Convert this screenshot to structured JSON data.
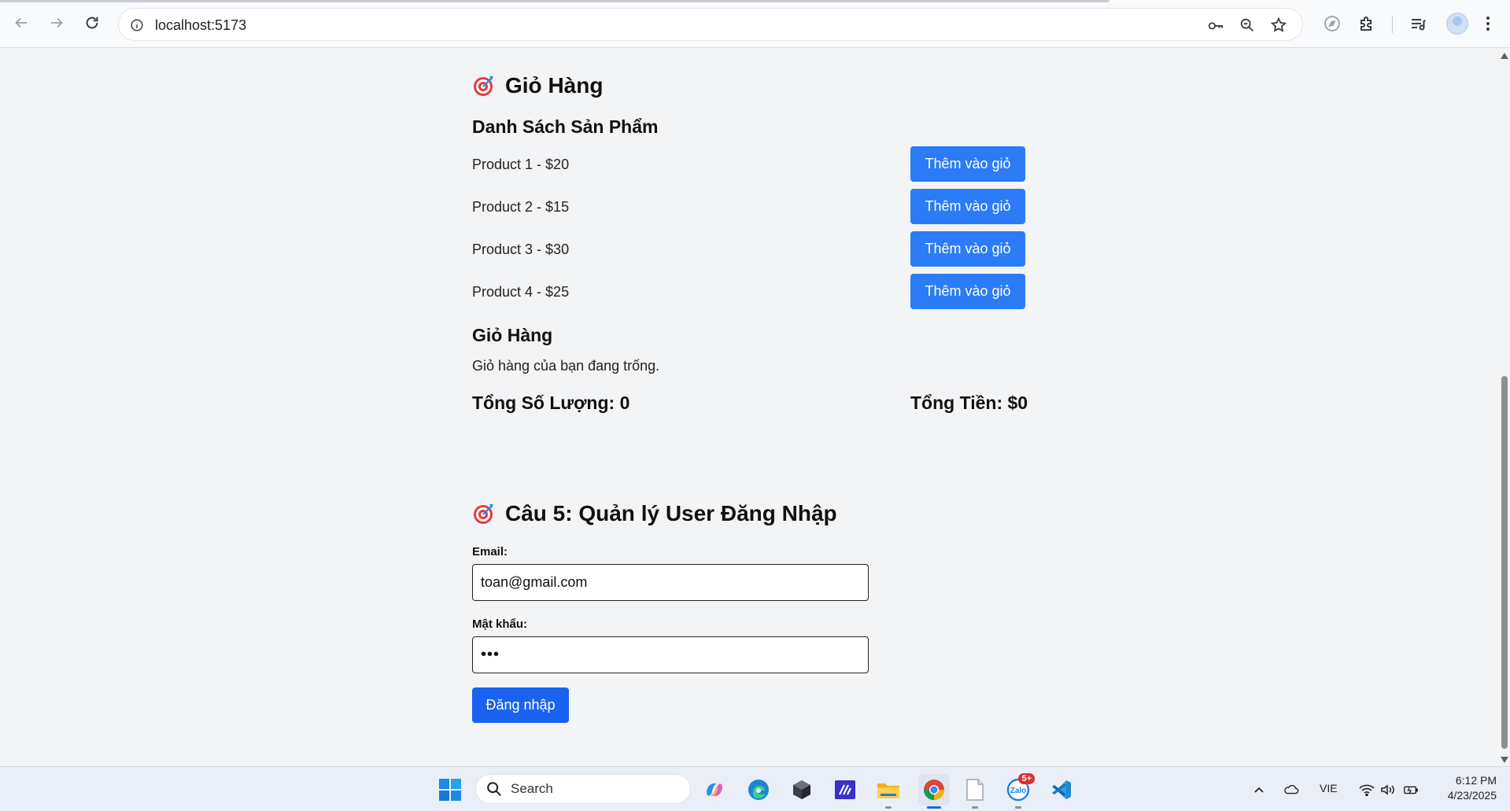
{
  "browser": {
    "url": "localhost:5173",
    "icons": [
      "back-icon",
      "forward-icon",
      "reload-icon",
      "site-info-icon",
      "password-key-icon",
      "zoom-icon",
      "bookmark-star-icon",
      "compass-icon",
      "extensions-icon",
      "media-control-icon",
      "profile-avatar",
      "more-menu-icon"
    ]
  },
  "cart_section": {
    "title": "Giỏ Hàng",
    "product_list_heading": "Danh Sách Sản Phẩm",
    "products": [
      {
        "label": "Product 1 - $20",
        "button": "Thêm vào giỏ"
      },
      {
        "label": "Product 2 - $15",
        "button": "Thêm vào giỏ"
      },
      {
        "label": "Product 3 - $30",
        "button": "Thêm vào giỏ"
      },
      {
        "label": "Product 4 - $25",
        "button": "Thêm vào giỏ"
      }
    ],
    "cart_heading": "Giỏ Hàng",
    "empty_message": "Giỏ hàng của bạn đang trống.",
    "total_quantity": "Tổng Số Lượng: 0",
    "total_price": "Tổng Tiền: $0"
  },
  "login_section": {
    "title": "Câu 5: Quản lý User Đăng Nhập",
    "email_label": "Email:",
    "email_value": "toan@gmail.com",
    "password_label": "Mật khẩu:",
    "password_value": "•••",
    "login_button": "Đăng nhập"
  },
  "taskbar": {
    "search_label": "Search",
    "apps": [
      "windows-start-icon",
      "copilot-icon",
      "edge-icon",
      "app-cube-icon",
      "visual-studio-icon",
      "file-explorer-icon",
      "chrome-icon",
      "notepad-icon",
      "zalo-icon",
      "vscode-icon"
    ],
    "zalo_badge": "5+",
    "language": "VIE",
    "time": "6:12 PM",
    "date": "4/23/2025"
  },
  "colors": {
    "add_button": "#2b7cf6",
    "login_button": "#1a62f0",
    "page_background": "#f3f4f6"
  }
}
